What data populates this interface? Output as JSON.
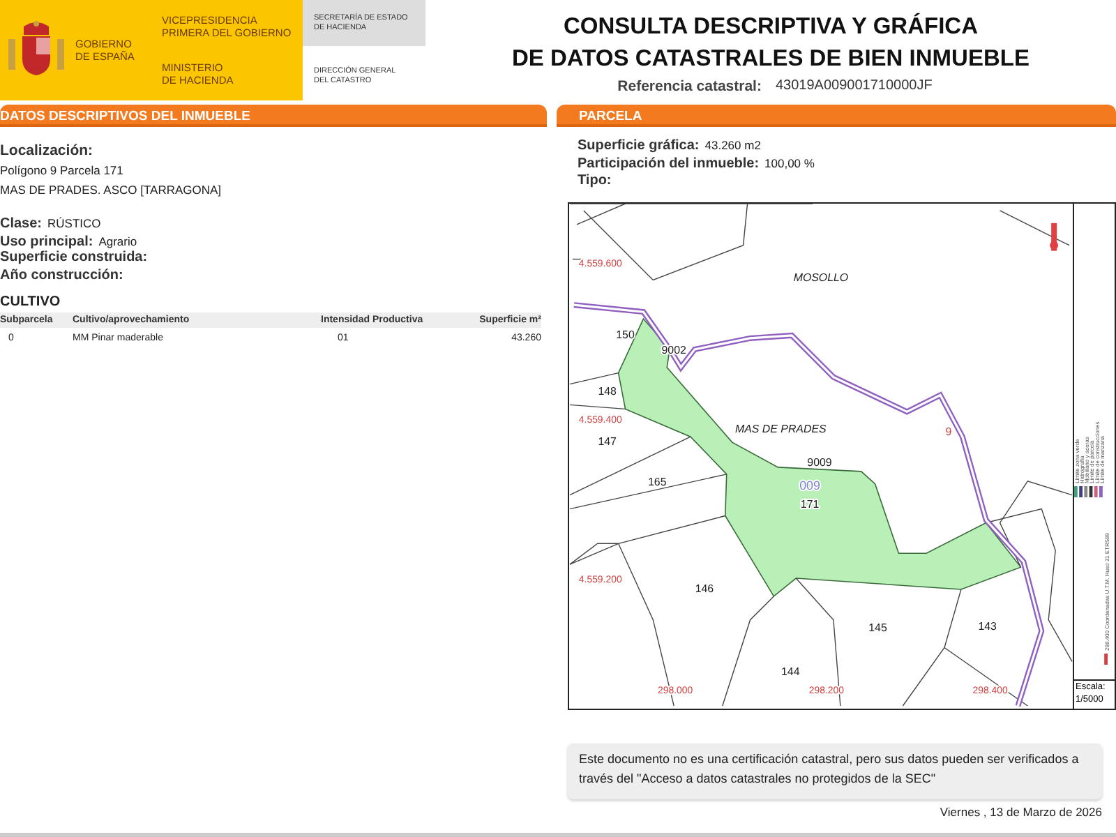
{
  "header": {
    "crown": [
      "GOBIERNO",
      "DE ESPAÑA"
    ],
    "ministry_top": [
      "VICEPRESIDENCIA",
      "PRIMERA DEL GOBIERNO"
    ],
    "ministry_bottom": [
      "MINISTERIO",
      "DE HACIENDA"
    ],
    "secretary": [
      "SECRETARÍA DE ESTADO",
      "DE HACIENDA"
    ],
    "directorate": [
      "DIRECCIÓN GENERAL",
      "DEL CATASTRO"
    ],
    "title": [
      "CONSULTA DESCRIPTIVA Y GRÁFICA",
      "DE DATOS CATASTRALES DE BIEN INMUEBLE"
    ],
    "reference_label": "Referencia catastral:",
    "reference_value": "43019A009001710000JF"
  },
  "descriptive": {
    "heading": "DATOS DESCRIPTIVOS DEL INMUEBLE",
    "location_label": "Localización:",
    "location_lines": [
      "Polígono 9 Parcela 171",
      "MAS DE PRADES. ASCO [TARRAGONA]"
    ],
    "fields": [
      {
        "label": "Clase:",
        "value": "RÚSTICO"
      },
      {
        "label": "Uso principal:",
        "value": "Agrario"
      },
      {
        "label": "Superficie construida:"
      },
      {
        "label": "Año construcción:"
      }
    ],
    "crop_heading": "CULTIVO",
    "table": {
      "columns": [
        "Subparcela",
        "Cultivo/aprovechamiento",
        "Intensidad Productiva",
        "Superficie m²"
      ],
      "rows": [
        [
          "0",
          "MM Pinar maderable",
          "01",
          "43.260"
        ]
      ]
    }
  },
  "parcel": {
    "heading": "PARCELA",
    "fields": [
      {
        "label": "Superficie gráfica:",
        "value": "43.260 m2"
      },
      {
        "label": "Participación del inmueble:",
        "value": "100,00 %"
      },
      {
        "label": "Tipo:"
      }
    ],
    "map": {
      "labels": [
        {
          "kind": "place",
          "text": "MOSOLLO"
        },
        {
          "kind": "place",
          "text": "MAS DE PRADES"
        },
        {
          "kind": "parcel",
          "text": "150"
        },
        {
          "kind": "parcel",
          "text": "9002"
        },
        {
          "kind": "parcel",
          "text": "148"
        },
        {
          "kind": "parcel",
          "text": "147"
        },
        {
          "kind": "parcel",
          "text": "9009"
        },
        {
          "kind": "block",
          "text": "009"
        },
        {
          "kind": "parcel",
          "text": "171"
        },
        {
          "kind": "parcel",
          "text": "165"
        },
        {
          "kind": "parcel",
          "text": "146"
        },
        {
          "kind": "parcel",
          "text": "145"
        },
        {
          "kind": "parcel",
          "text": "143"
        },
        {
          "kind": "parcel",
          "text": "144"
        },
        {
          "kind": "block-mark",
          "text": "9"
        },
        {
          "kind": "coord",
          "text": "4.559.600"
        },
        {
          "kind": "coord",
          "text": "4.559.400"
        },
        {
          "kind": "coord",
          "text": "4.559.200"
        },
        {
          "kind": "coord",
          "text": "298.000"
        },
        {
          "kind": "coord",
          "text": "298.200"
        },
        {
          "kind": "coord",
          "text": "298.400"
        }
      ],
      "legend": [
        {
          "text": "298.400 Coordenadas U.T.M. Huso 31 ETRS89",
          "color": "#d04040"
        },
        {
          "text": "Límite de manzana",
          "color": "#9060c0"
        },
        {
          "text": "Límite de construcciones",
          "color": "#d06080"
        },
        {
          "text": "Límite de parcela",
          "color": "#333333"
        },
        {
          "text": "Mobiliario y aceras",
          "color": "#888888"
        },
        {
          "text": "Hidrografía",
          "color": "#404080"
        },
        {
          "text": "Límite zona verde",
          "color": "#40a080"
        }
      ],
      "scale_label": "Escala:",
      "scale_value": "1/5000"
    }
  },
  "note": "Este documento no es una certificación catastral, pero sus datos pueden ser verificados a través del \"Acceso a datos catastrales no protegidos de la SEC\"",
  "date": "Viernes , 13 de Marzo de 2026"
}
